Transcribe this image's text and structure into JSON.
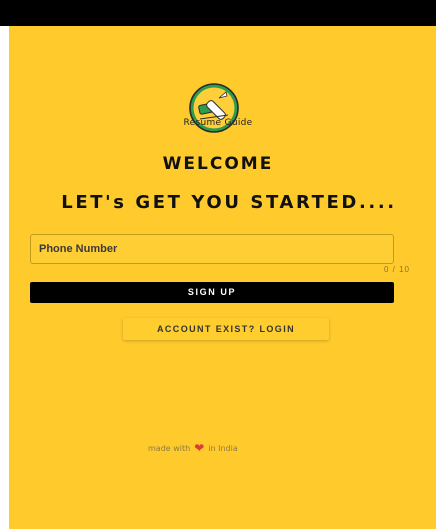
{
  "app": {
    "name": "Resume Guide"
  },
  "colors": {
    "background": "#ffcb2c",
    "status_bar": "#000000",
    "primary_button": "#000000",
    "primary_button_text": "#ffffff",
    "heart": "#e03a3a"
  },
  "icons": {
    "logo": "resume-guide-logo-icon",
    "heart": "heart-icon"
  },
  "header": {
    "welcome": "WELCOME",
    "subtitle": "LET's GET YOU STARTED...."
  },
  "form": {
    "phone_placeholder": "Phone Number",
    "phone_value": "",
    "counter": "0 / 10",
    "signup_label": "SIGN UP",
    "login_label": "ACCOUNT EXIST? LOGIN"
  },
  "footer": {
    "prefix": "made with",
    "suffix": "in India",
    "heart_glyph": "❤"
  }
}
